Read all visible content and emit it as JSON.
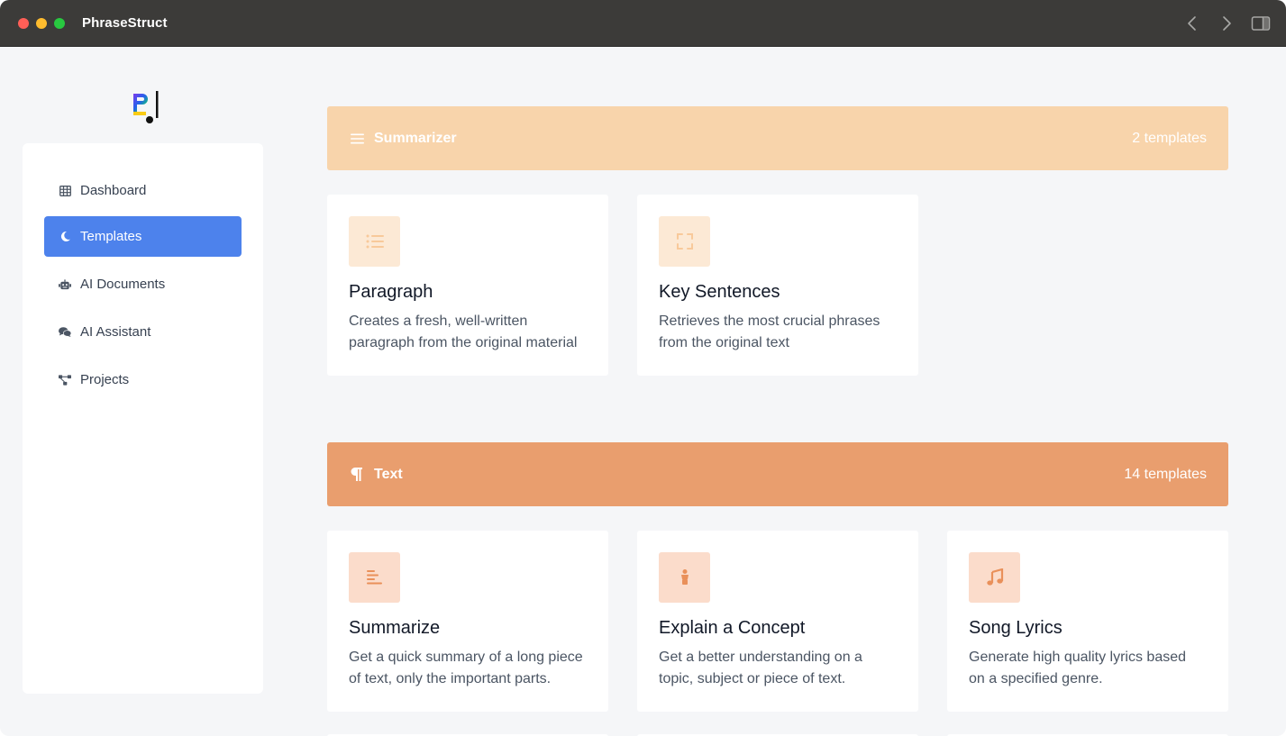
{
  "app": {
    "title": "PhraseStruct"
  },
  "colors": {
    "accent": "#4d82ec",
    "summarizer_banner": "#f8d4ab",
    "text_banner": "#e99e6e"
  },
  "sidebar": {
    "items": [
      {
        "label": "Dashboard",
        "icon": "table-icon",
        "active": false
      },
      {
        "label": "Templates",
        "icon": "moon-icon",
        "active": true
      },
      {
        "label": "AI Documents",
        "icon": "robot-icon",
        "active": false
      },
      {
        "label": "AI Assistant",
        "icon": "comments-icon",
        "active": false
      },
      {
        "label": "Projects",
        "icon": "diagram-icon",
        "active": false
      }
    ]
  },
  "categories": [
    {
      "title": "Summarizer",
      "icon": "bars-icon",
      "count": "2 templates",
      "cards": [
        {
          "title": "Paragraph",
          "desc_lines": [
            "Creates a fresh, well-written",
            "paragraph from the original material"
          ],
          "icon": "list-icon"
        },
        {
          "title": "Key Sentences",
          "desc_lines": [
            "Retrieves the most crucial phrases",
            "from the original text"
          ],
          "icon": "expand-icon"
        }
      ]
    },
    {
      "title": "Text",
      "icon": "paragraph-icon",
      "count": "14 templates",
      "cards": [
        {
          "title": "Summarize",
          "desc_lines": [
            "Get a quick summary of a long piece",
            "of text, only the important parts."
          ],
          "icon": "align-left-icon"
        },
        {
          "title": "Explain a Concept",
          "desc_lines": [
            "Get a better understanding on a",
            "topic, subject or piece of text."
          ],
          "icon": "child-icon"
        },
        {
          "title": "Song Lyrics",
          "desc_lines": [
            "Generate high quality lyrics based",
            "on a specified genre."
          ],
          "icon": "music-icon"
        }
      ]
    }
  ]
}
